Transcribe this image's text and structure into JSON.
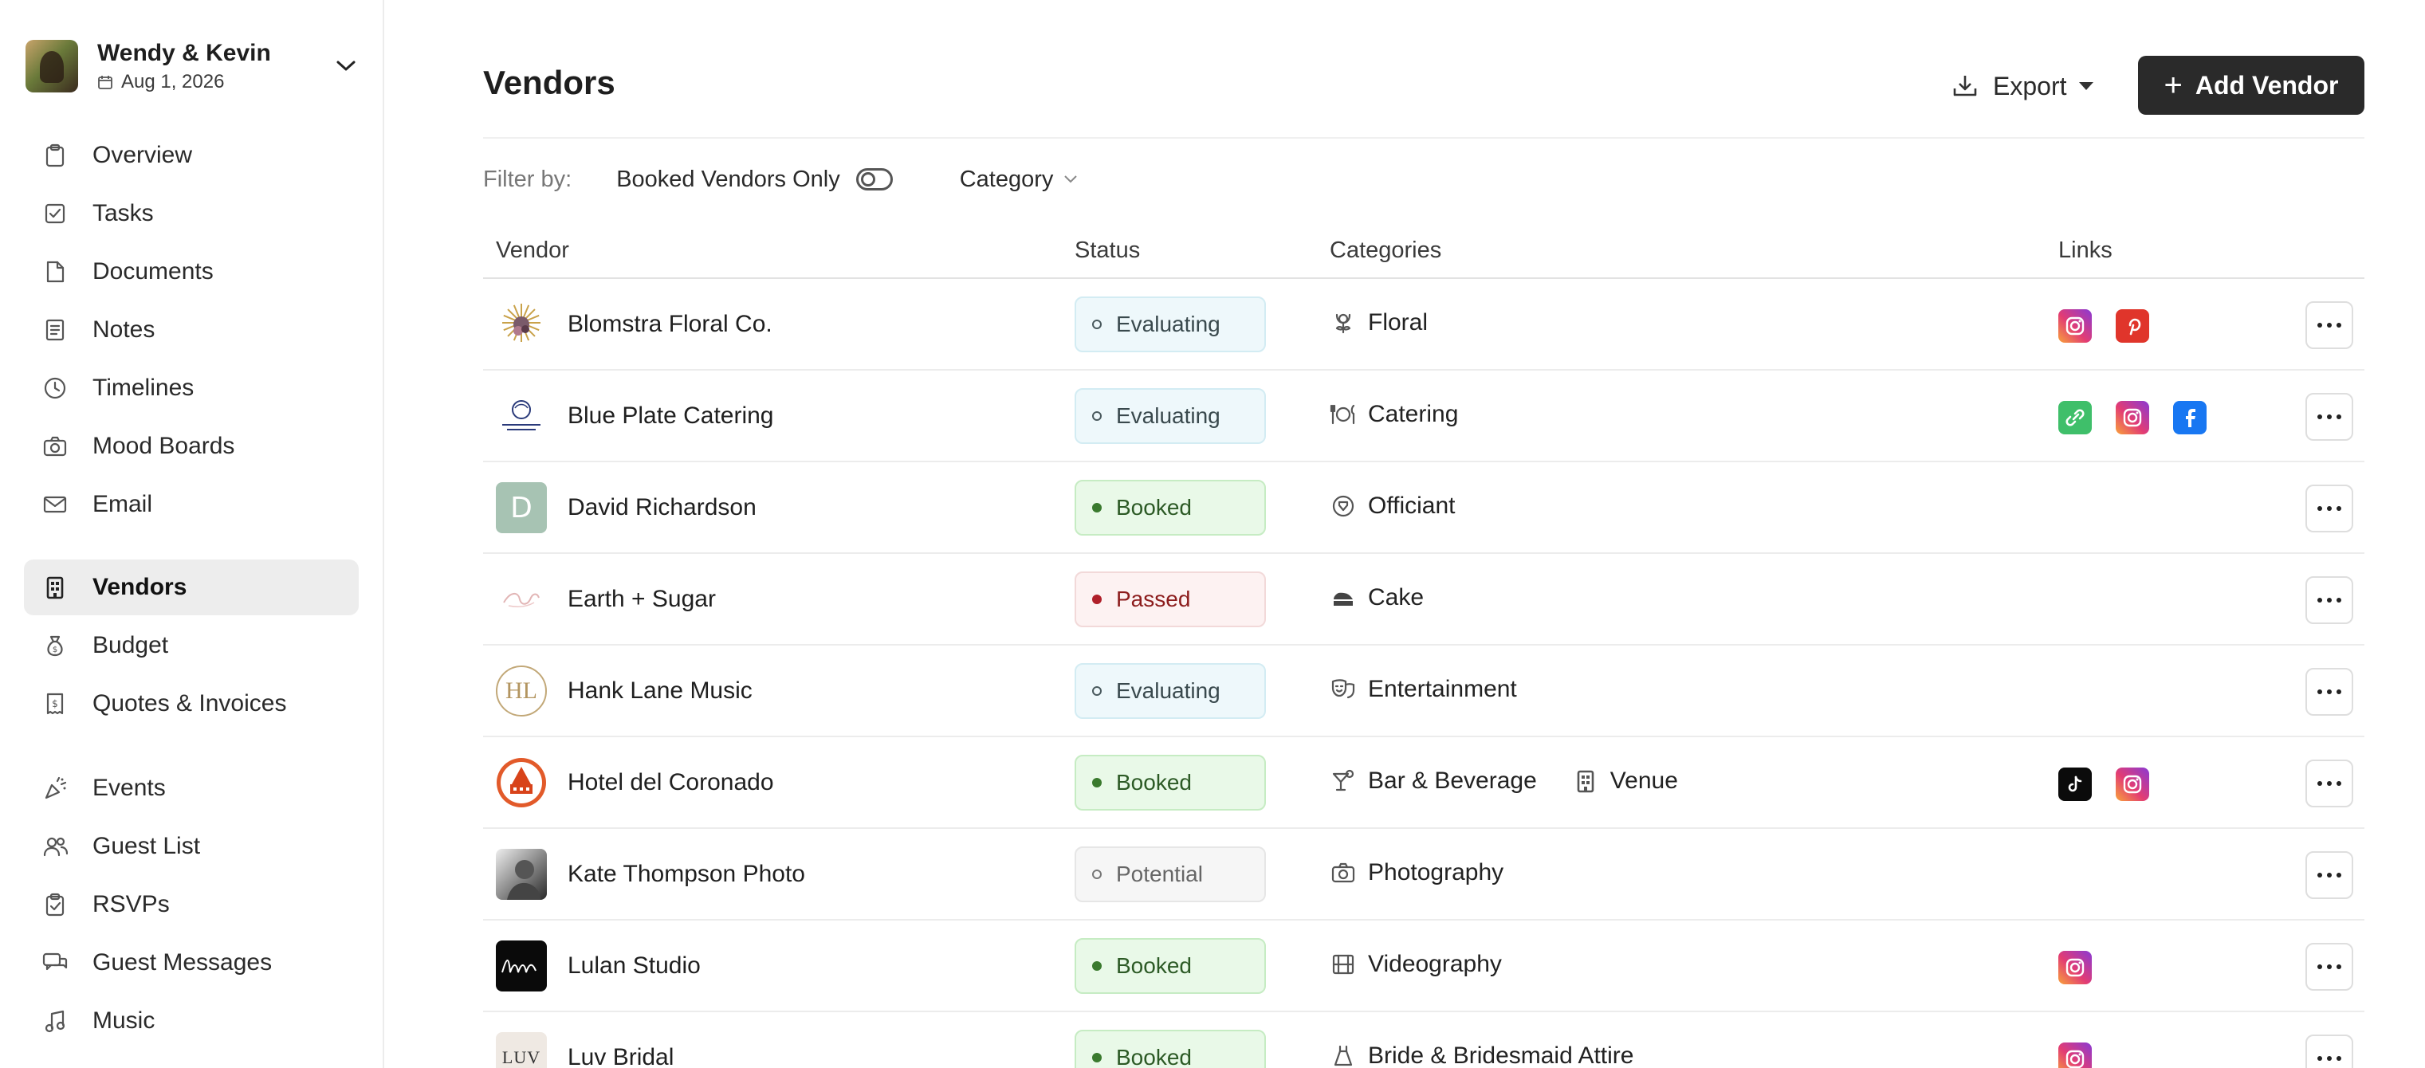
{
  "sidebar": {
    "couple": {
      "name": "Wendy & Kevin",
      "date": "Aug 1, 2026"
    },
    "nav_primary": [
      {
        "label": "Overview",
        "icon": "clipboard-icon"
      },
      {
        "label": "Tasks",
        "icon": "checkbox-icon"
      },
      {
        "label": "Documents",
        "icon": "document-icon"
      },
      {
        "label": "Notes",
        "icon": "notes-icon"
      },
      {
        "label": "Timelines",
        "icon": "clock-icon"
      },
      {
        "label": "Mood Boards",
        "icon": "camera-icon"
      },
      {
        "label": "Email",
        "icon": "mail-icon"
      }
    ],
    "nav_secondary": [
      {
        "label": "Vendors",
        "icon": "building-icon",
        "active": true
      },
      {
        "label": "Budget",
        "icon": "money-bag-icon"
      },
      {
        "label": "Quotes & Invoices",
        "icon": "receipt-icon"
      }
    ],
    "nav_tertiary": [
      {
        "label": "Events",
        "icon": "party-icon"
      },
      {
        "label": "Guest List",
        "icon": "users-icon"
      },
      {
        "label": "RSVPs",
        "icon": "clipboard-check-icon"
      },
      {
        "label": "Guest Messages",
        "icon": "messages-icon"
      },
      {
        "label": "Music",
        "icon": "music-icon"
      }
    ]
  },
  "header": {
    "title": "Vendors",
    "export_label": "Export",
    "add_label": "Add Vendor"
  },
  "filters": {
    "label": "Filter by:",
    "booked_only": "Booked Vendors Only",
    "booked_only_on": false,
    "category": "Category"
  },
  "columns": {
    "vendor": "Vendor",
    "status": "Status",
    "categories": "Categories",
    "links": "Links"
  },
  "vendors": [
    {
      "name": "Blomstra Floral Co.",
      "status": "Evaluating",
      "status_kind": "eval",
      "logo": "flower-logo",
      "categories": [
        {
          "label": "Floral",
          "icon": "flower-icon"
        }
      ],
      "links": [
        "instagram",
        "pinterest"
      ]
    },
    {
      "name": "Blue Plate Catering",
      "status": "Evaluating",
      "status_kind": "eval",
      "logo": "blue-plate-logo",
      "categories": [
        {
          "label": "Catering",
          "icon": "plate-icon"
        }
      ],
      "links": [
        "website",
        "instagram",
        "facebook"
      ]
    },
    {
      "name": "David Richardson",
      "status": "Booked",
      "status_kind": "booked",
      "logo": "D",
      "categories": [
        {
          "label": "Officiant",
          "icon": "officiant-icon"
        }
      ],
      "links": []
    },
    {
      "name": "Earth + Sugar",
      "status": "Passed",
      "status_kind": "passed",
      "logo": "script-logo",
      "categories": [
        {
          "label": "Cake",
          "icon": "cake-icon"
        }
      ],
      "links": []
    },
    {
      "name": "Hank Lane Music",
      "status": "Evaluating",
      "status_kind": "eval",
      "logo": "HL",
      "categories": [
        {
          "label": "Entertainment",
          "icon": "masks-icon"
        }
      ],
      "links": []
    },
    {
      "name": "Hotel del Coronado",
      "status": "Booked",
      "status_kind": "booked",
      "logo": "hotel-logo",
      "categories": [
        {
          "label": "Bar & Beverage",
          "icon": "cocktail-icon"
        },
        {
          "label": "Venue",
          "icon": "building-icon"
        }
      ],
      "links": [
        "tiktok",
        "instagram"
      ]
    },
    {
      "name": "Kate Thompson Photo",
      "status": "Potential",
      "status_kind": "potential",
      "logo": "photo-logo",
      "categories": [
        {
          "label": "Photography",
          "icon": "camera-icon"
        }
      ],
      "links": []
    },
    {
      "name": "Lulan Studio",
      "status": "Booked",
      "status_kind": "booked",
      "logo": "lulan-logo",
      "categories": [
        {
          "label": "Videography",
          "icon": "film-icon"
        }
      ],
      "links": [
        "instagram"
      ]
    },
    {
      "name": "Luv Bridal",
      "status": "Booked",
      "status_kind": "booked",
      "logo": "LUV",
      "categories": [
        {
          "label": "Bride & Bridesmaid Attire",
          "icon": "dress-icon"
        }
      ],
      "links": [
        "instagram"
      ]
    }
  ]
}
